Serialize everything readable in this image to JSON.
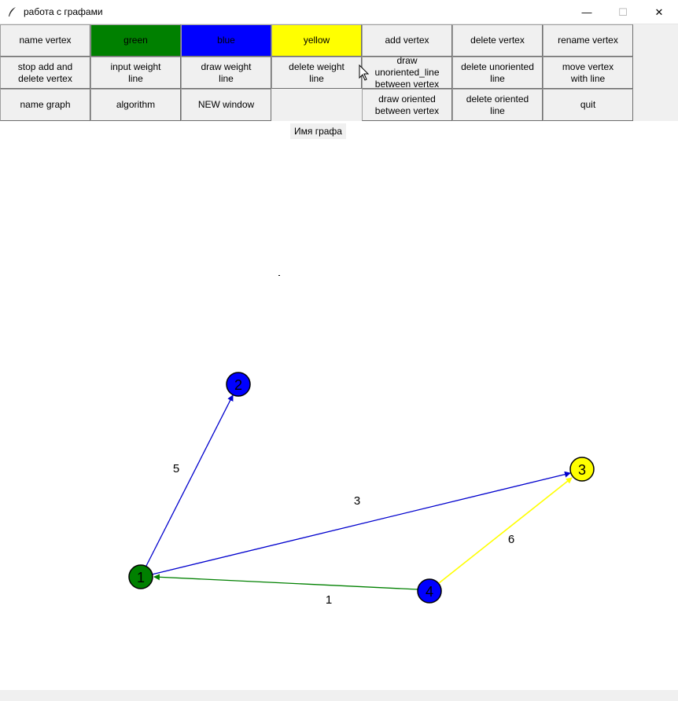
{
  "window": {
    "title": "работа с графами",
    "controls": {
      "minimize": "—",
      "maximize": "☐",
      "close": "✕"
    }
  },
  "toolbar": {
    "row1": [
      {
        "label": "name vertex",
        "color": "#f0f0f0"
      },
      {
        "label": "green",
        "color": "#008000"
      },
      {
        "label": "blue",
        "color": "#0000ff"
      },
      {
        "label": "yellow",
        "color": "#ffff00"
      },
      {
        "label": "add vertex",
        "color": "#f0f0f0"
      },
      {
        "label": "delete vertex",
        "color": "#f0f0f0"
      },
      {
        "label": "rename vertex",
        "color": "#f0f0f0"
      }
    ],
    "row2": [
      {
        "label": "stop add and\ndelete vertex"
      },
      {
        "label": "input weight\nline"
      },
      {
        "label": "draw weight\nline"
      },
      {
        "label": "delete weight\nline"
      },
      {
        "label": "draw unoriented_line\nbetween vertex"
      },
      {
        "label": "delete unoriented\nline"
      },
      {
        "label": "move vertex\nwith line"
      }
    ],
    "row3": [
      {
        "label": "name graph"
      },
      {
        "label": "algorithm"
      },
      {
        "label": "NEW window"
      },
      {
        "label": ""
      },
      {
        "label": "draw oriented\nbetween vertex"
      },
      {
        "label": "delete oriented\nline"
      },
      {
        "label": "quit"
      }
    ]
  },
  "graph_name_label": "Имя графа",
  "graph": {
    "vertices": [
      {
        "id": "1",
        "color": "#008000"
      },
      {
        "id": "2",
        "color": "#0000ff"
      },
      {
        "id": "3",
        "color": "#ffff00"
      },
      {
        "id": "4",
        "color": "#0000ff"
      }
    ],
    "edges": [
      {
        "from": "1",
        "to": "2",
        "weight": "5",
        "color": "#0000cd"
      },
      {
        "from": "1",
        "to": "3",
        "weight": "3",
        "color": "#0000cd"
      },
      {
        "from": "4",
        "to": "1",
        "weight": "1",
        "color": "#008000"
      },
      {
        "from": "4",
        "to": "3",
        "weight": "6",
        "color": "#ffff00"
      }
    ]
  }
}
